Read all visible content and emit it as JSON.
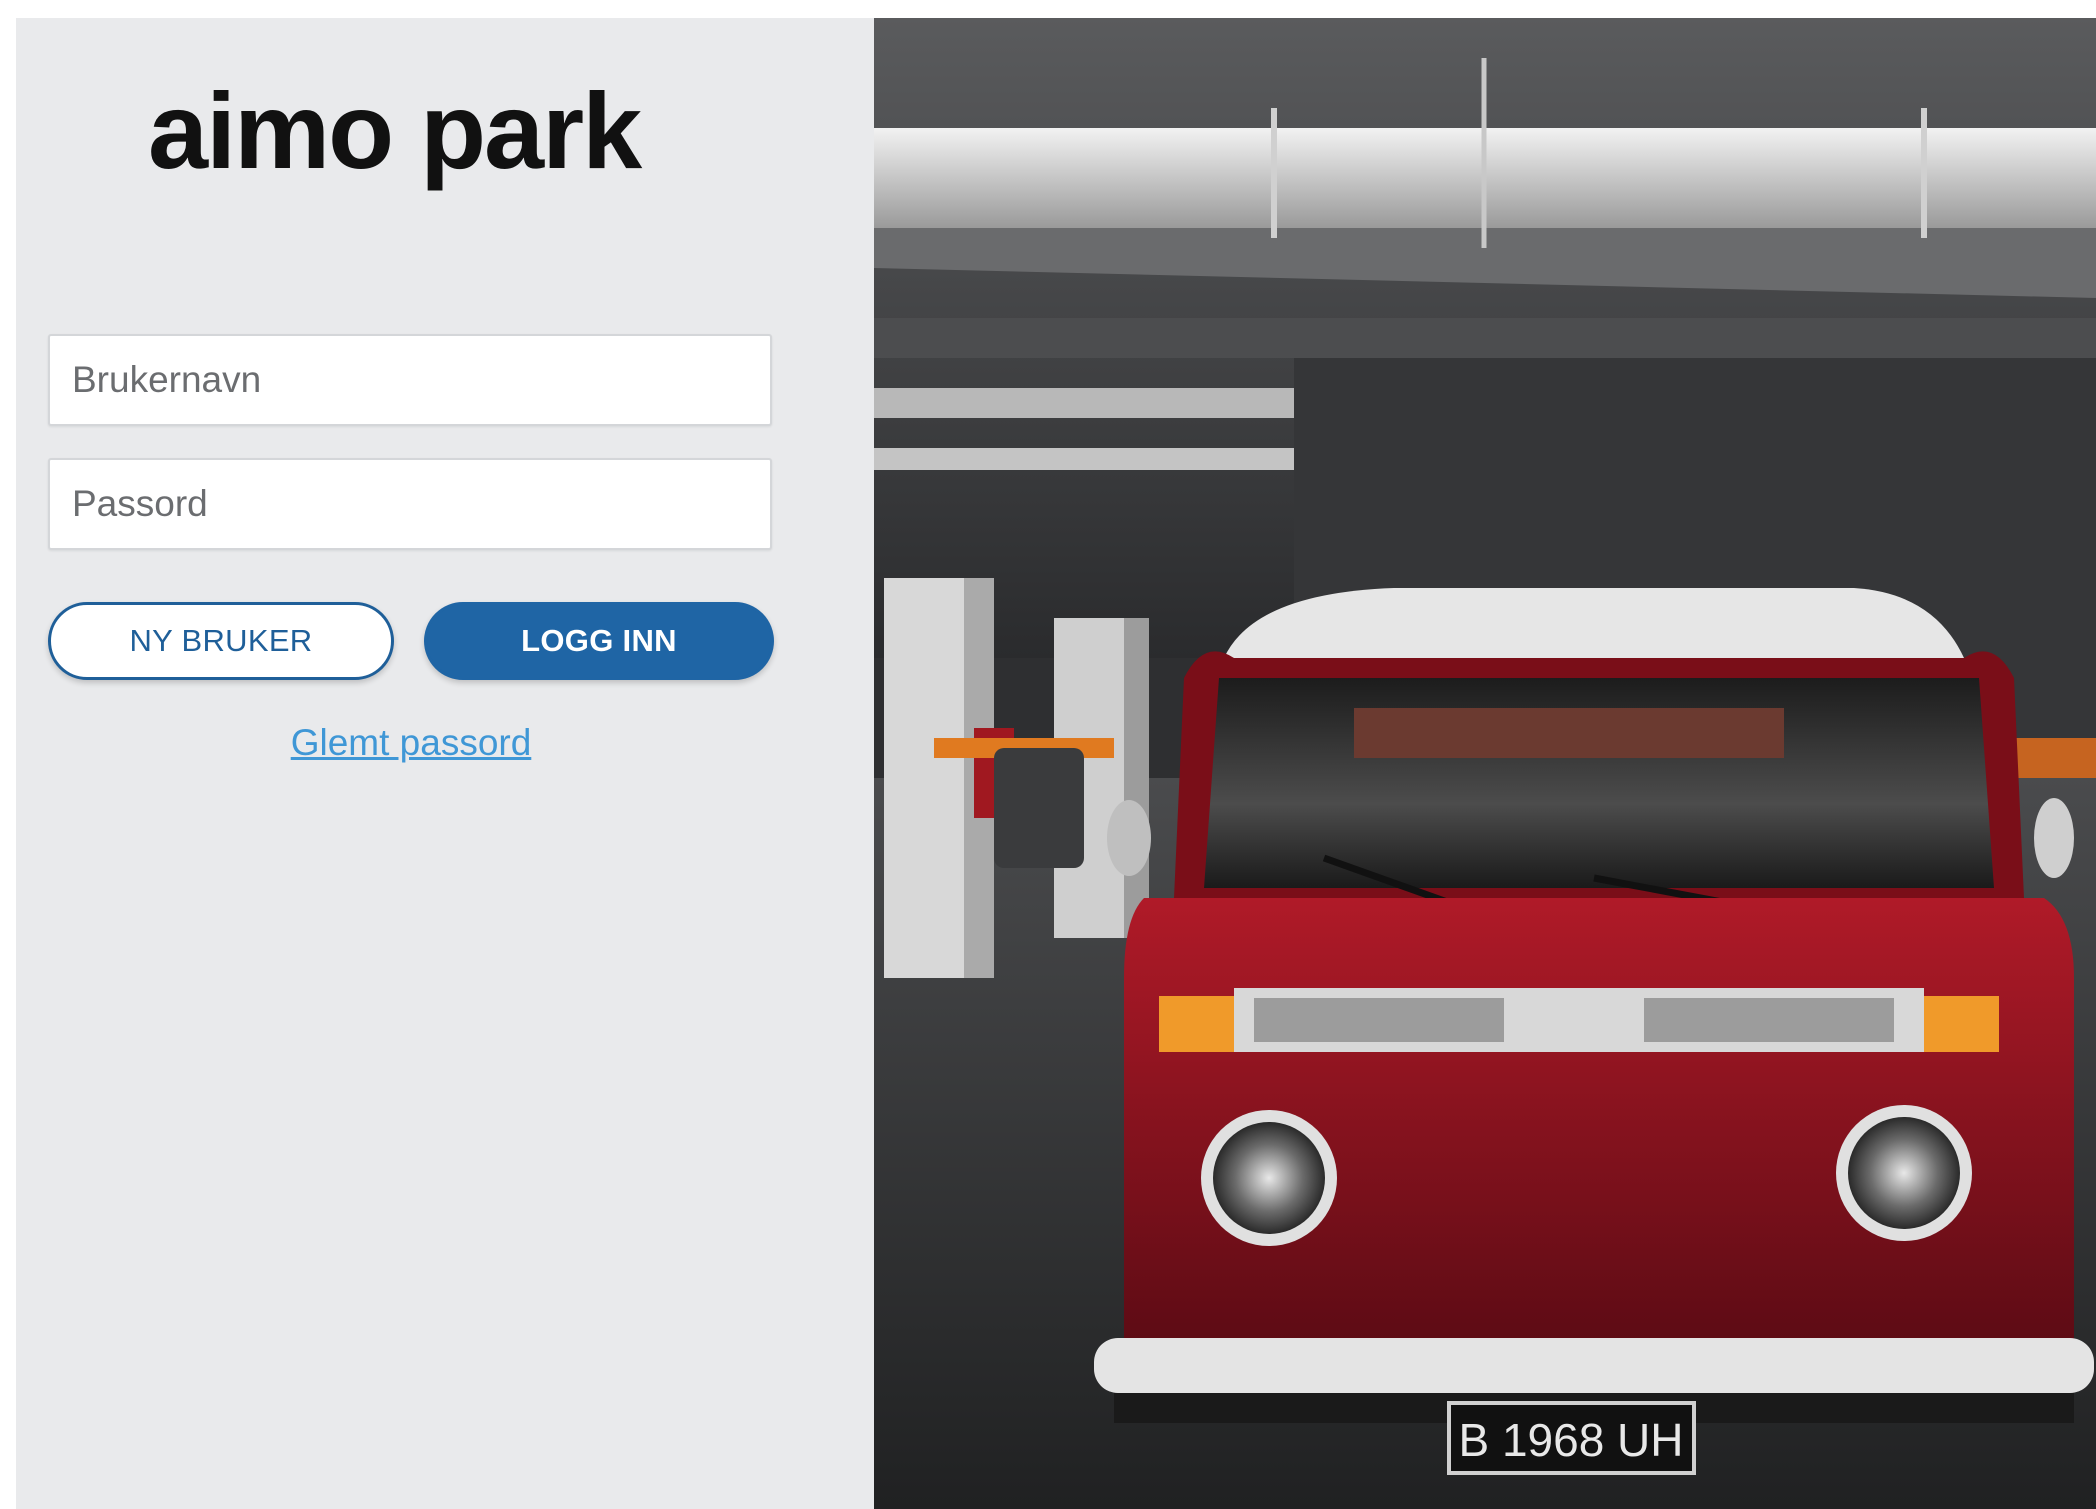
{
  "brand": {
    "logo_text": "aimo park"
  },
  "login_form": {
    "username_placeholder": "Brukernavn",
    "password_placeholder": "Passord",
    "new_user_label": "NY BRUKER",
    "login_label": "LOGG INN",
    "forgot_password_label": "Glemt passord"
  },
  "hero": {
    "plate_text": "B 1968 UH"
  },
  "colors": {
    "primary": "#1f65a5",
    "link": "#3f97d6",
    "panel_background": "#e9eaec",
    "van_red": "#8e1420"
  }
}
